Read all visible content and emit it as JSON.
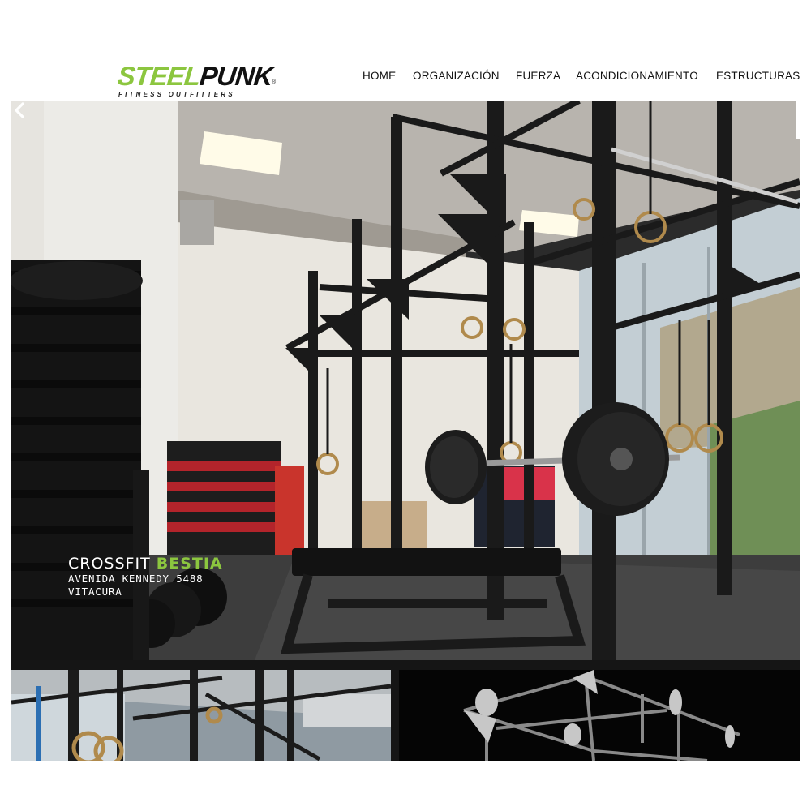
{
  "logo": {
    "brand_part1": "STEEL",
    "brand_part2": "PUNK",
    "registered": "®",
    "tagline": "FITNESS OUTFITTERS",
    "colors": {
      "primary": "#8cc63f",
      "secondary": "#111111"
    }
  },
  "nav": {
    "items": [
      {
        "label": "HOME"
      },
      {
        "label": "ORGANIZACIÓN"
      },
      {
        "label": "FUERZA"
      },
      {
        "label": "ACONDICIONAMIENTO"
      },
      {
        "label": "ESTRUCTURAS"
      }
    ]
  },
  "slider": {
    "prev_icon": "chevron-left-icon",
    "caption": {
      "title_prefix": "CROSSFIT",
      "title_accent": "BESTIA",
      "address": "AVENIDA KENNEDY 5488",
      "city": "VITACURA"
    },
    "accent_color": "#8cc63f"
  },
  "thumbnails": [
    {
      "icon": "gym-rings-thumbnail"
    },
    {
      "icon": "rig-structure-thumbnail"
    }
  ]
}
